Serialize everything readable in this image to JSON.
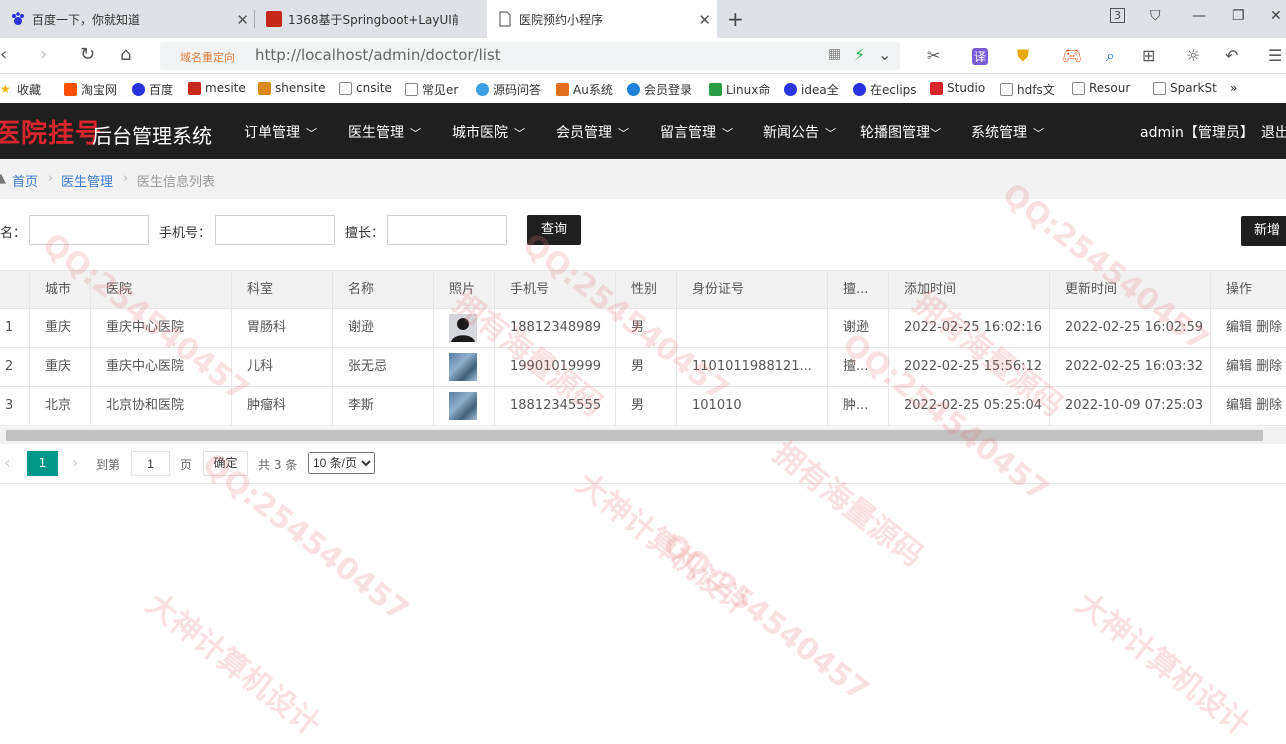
{
  "browser": {
    "tabs": [
      {
        "title": "百度一下，你就知道"
      },
      {
        "title": "1368基于Springboot+LayUI前"
      },
      {
        "title": "医院预约小程序"
      }
    ],
    "window_badge": "3",
    "redirect_label": "域名重定向",
    "url": "http://localhost/admin/doctor/list"
  },
  "bookmarks": [
    "收藏",
    "淘宝网",
    "百度",
    "mesite",
    "shensite",
    "cnsite",
    "常见er",
    "源码问答",
    "Au系统",
    "会员登录",
    "Linux命",
    "idea全",
    "在eclips",
    "Studio",
    "hdfs文",
    "Resour",
    "SparkSt",
    "»"
  ],
  "app": {
    "logo_red": "医院挂号",
    "logo_white": "后台管理系统",
    "menu": [
      "订单管理",
      "医生管理",
      "城市医院",
      "会员管理",
      "留言管理",
      "新闻公告",
      "轮播图管理",
      "系统管理"
    ],
    "user": "admin【管理员】",
    "logout": "退出"
  },
  "breadcrumb": {
    "home": "首页",
    "section": "医生管理",
    "current": "医生信息列表"
  },
  "search": {
    "name_label": "名：",
    "phone_label": "手机号：",
    "specialty_label": "擅长：",
    "query_button": "查询",
    "add_button": "新增"
  },
  "table": {
    "headers": [
      "",
      "城市",
      "医院",
      "科室",
      "名称",
      "照片",
      "手机号",
      "性别",
      "身份证号",
      "擅...",
      "添加时间",
      "更新时间",
      "操作"
    ],
    "rows": [
      {
        "no": "1",
        "city": "重庆",
        "hospital": "重庆中心医院",
        "dept": "胃肠科",
        "name": "谢逊",
        "phone": "18812348989",
        "gender": "男",
        "id_no": "",
        "specialty": "谢逊",
        "created": "2022-02-25 16:02:16",
        "updated": "2022-02-25 16:02:59",
        "photo": "person"
      },
      {
        "no": "2",
        "city": "重庆",
        "hospital": "重庆中心医院",
        "dept": "儿科",
        "name": "张无忌",
        "phone": "19901019999",
        "gender": "男",
        "id_no": "1101011988121...",
        "specialty": "擅...",
        "created": "2022-02-25 15:56:12",
        "updated": "2022-02-25 16:03:32",
        "photo": "pic"
      },
      {
        "no": "3",
        "city": "北京",
        "hospital": "北京协和医院",
        "dept": "肿瘤科",
        "name": "李斯",
        "phone": "18812345555",
        "gender": "男",
        "id_no": "101010",
        "specialty": "肿...",
        "created": "2022-02-25 05:25:04",
        "updated": "2022-10-09 07:25:03",
        "photo": "pic"
      }
    ],
    "edit_label": "编辑",
    "delete_label": "删除"
  },
  "pager": {
    "current": "1",
    "goto_label": "到第",
    "goto_value": "1",
    "page_unit": "页",
    "confirm": "确定",
    "total": "共 3 条",
    "per_page": "10 条/页"
  },
  "watermark": [
    "QQ:254540457",
    "大神计算机设计",
    "拥有海量源码"
  ],
  "colors": {
    "header_bg": "#1f1f1f",
    "logo_red": "#d9262c",
    "pager_active": "#009688",
    "link": "#3a7bd5"
  }
}
